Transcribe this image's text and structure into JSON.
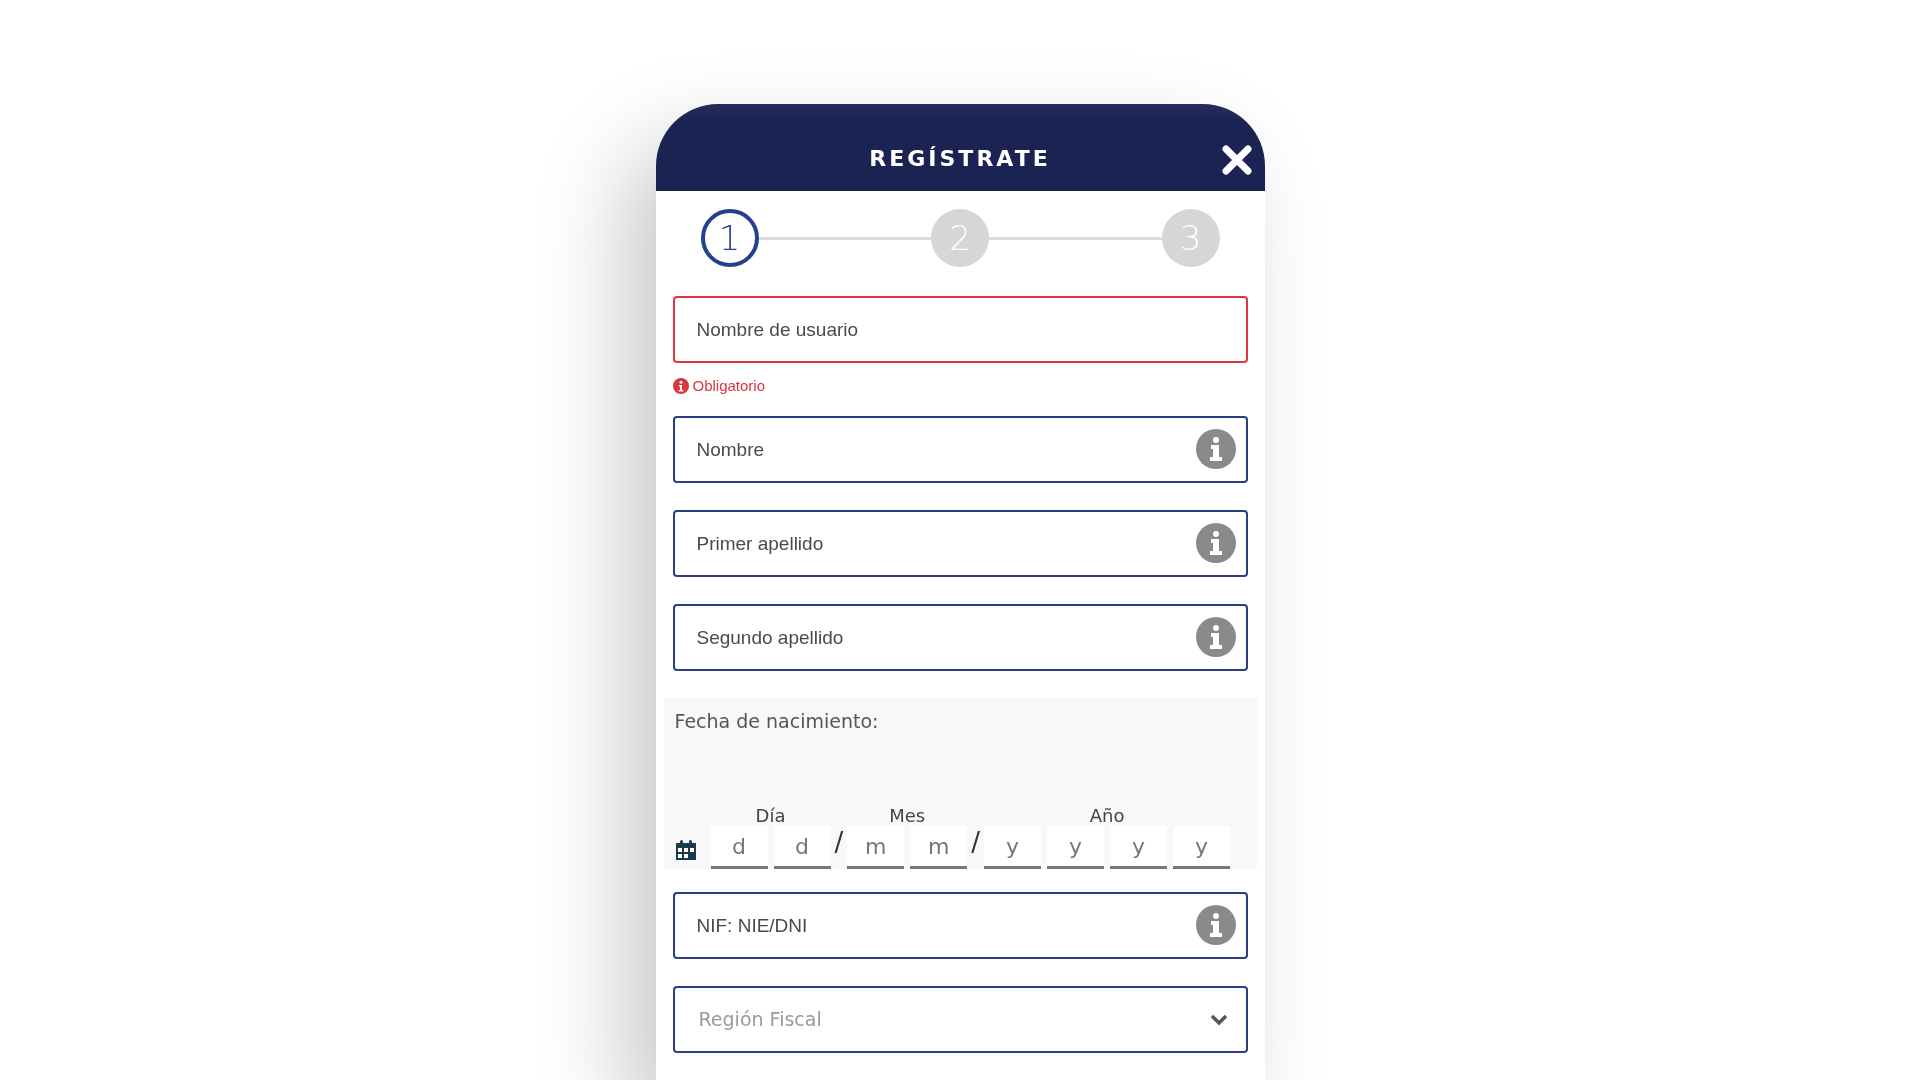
{
  "header": {
    "title": "REGÍSTRATE"
  },
  "steps": [
    {
      "label": "1",
      "selected": true
    },
    {
      "label": "2",
      "selected": false
    },
    {
      "label": "3",
      "selected": false
    }
  ],
  "fields_top": [
    {
      "kind": "text",
      "placeholder": "Nombre de usuario",
      "invalid": true,
      "message": "Obligatorio",
      "info_button": false
    },
    {
      "kind": "text",
      "placeholder": "Nombre",
      "invalid": false,
      "info_button": true
    },
    {
      "kind": "text",
      "placeholder": "Primer apellido",
      "invalid": false,
      "info_button": true
    },
    {
      "kind": "text",
      "placeholder": "Segundo apellido",
      "invalid": false,
      "info_button": true
    }
  ],
  "birth_date": {
    "label": "Fecha de nacimiento:",
    "groups": [
      {
        "label": "Día",
        "slots": [
          {
            "placeholder": "d"
          },
          {
            "placeholder": "d"
          }
        ],
        "separator_after": "/"
      },
      {
        "label": "Mes",
        "slots": [
          {
            "placeholder": "m"
          },
          {
            "placeholder": "m"
          }
        ],
        "separator_after": "/"
      },
      {
        "label": "Año",
        "slots": [
          {
            "placeholder": "y"
          },
          {
            "placeholder": "y"
          },
          {
            "placeholder": "y"
          },
          {
            "placeholder": "y"
          }
        ]
      }
    ]
  },
  "fields_bottom": [
    {
      "kind": "text",
      "placeholder": "NIF: NIE/DNI",
      "invalid": false,
      "info_button": true
    },
    {
      "kind": "select",
      "placeholder": "Región Fiscal",
      "invalid": false,
      "info_button": false
    }
  ]
}
